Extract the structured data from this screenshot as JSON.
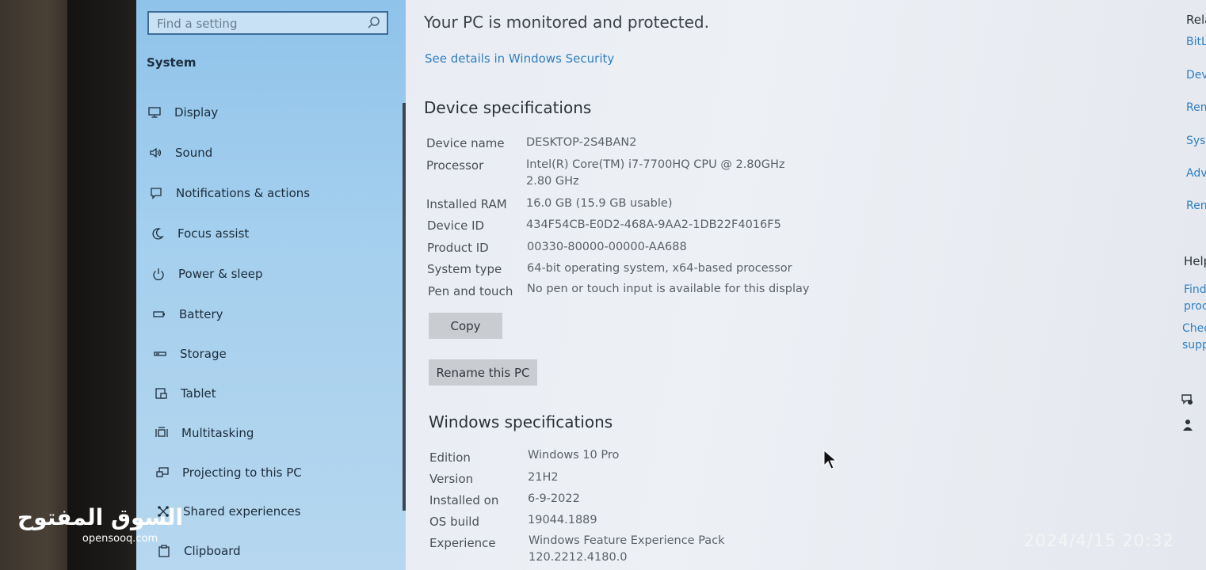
{
  "search": {
    "placeholder": "Find a setting"
  },
  "sidebar": {
    "title": "System",
    "items": [
      {
        "label": "Display",
        "icon": "monitor-icon"
      },
      {
        "label": "Sound",
        "icon": "speaker-icon"
      },
      {
        "label": "Notifications & actions",
        "icon": "notification-icon"
      },
      {
        "label": "Focus assist",
        "icon": "moon-icon"
      },
      {
        "label": "Power & sleep",
        "icon": "power-icon"
      },
      {
        "label": "Battery",
        "icon": "battery-icon"
      },
      {
        "label": "Storage",
        "icon": "storage-icon"
      },
      {
        "label": "Tablet",
        "icon": "tablet-icon"
      },
      {
        "label": "Multitasking",
        "icon": "multitasking-icon"
      },
      {
        "label": "Projecting to this PC",
        "icon": "projector-icon"
      },
      {
        "label": "Shared experiences",
        "icon": "shared-experiences-icon"
      },
      {
        "label": "Clipboard",
        "icon": "clipboard-icon"
      }
    ]
  },
  "main": {
    "protected_text": "Your PC is monitored and protected.",
    "security_link": "See details in Windows Security",
    "device_heading": "Device specifications",
    "device_specs": [
      {
        "label": "Device name",
        "value": "DESKTOP-2S4BAN2"
      },
      {
        "label": "Processor",
        "value": "Intel(R) Core(TM) i7-7700HQ CPU @ 2.80GHz",
        "value2": "2.80 GHz"
      },
      {
        "label": "Installed RAM",
        "value": "16.0 GB (15.9 GB usable)"
      },
      {
        "label": "Device ID",
        "value": "434F54CB-E0D2-468A-9AA2-1DB22F4016F5"
      },
      {
        "label": "Product ID",
        "value": "00330-80000-00000-AA688"
      },
      {
        "label": "System type",
        "value": "64-bit operating system, x64-based processor"
      },
      {
        "label": "Pen and touch",
        "value": "No pen or touch input is available for this display"
      }
    ],
    "copy_button": "Copy",
    "rename_button": "Rename this PC",
    "windows_heading": "Windows specifications",
    "windows_specs": [
      {
        "label": "Edition",
        "value": "Windows 10 Pro"
      },
      {
        "label": "Version",
        "value": "21H2"
      },
      {
        "label": "Installed on",
        "value": "6-9-2022"
      },
      {
        "label": "OS build",
        "value": "19044.1889"
      },
      {
        "label": "Experience",
        "value": "Windows Feature Experience Pack",
        "value2": "120.2212.4180.0"
      }
    ]
  },
  "related": {
    "heading": "Rela",
    "links": [
      "BitL",
      "Dev",
      "Rem",
      "Syst",
      "Adv",
      "Rena"
    ],
    "help_heading": "Help",
    "help_links": [
      "Find",
      "proc",
      "Chec",
      "supp"
    ]
  },
  "overlay": {
    "watermark_ar": "السوق المفتوح",
    "watermark_en": "opensooq.com",
    "timestamp": "2024/4/15 20:32"
  }
}
